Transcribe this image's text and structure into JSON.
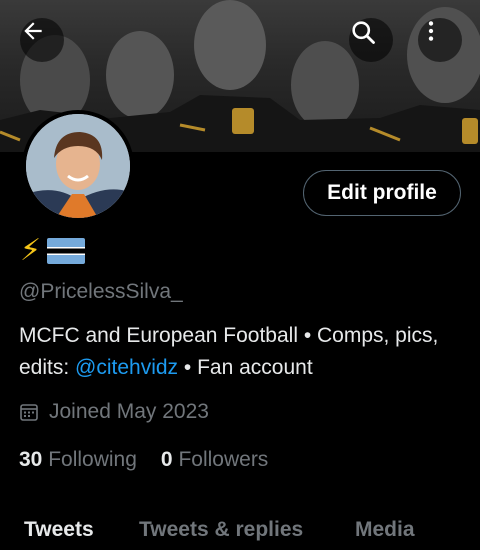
{
  "header": {
    "back_icon": "arrow-left-icon",
    "search_icon": "search-icon",
    "more_icon": "more-vertical-icon"
  },
  "profile": {
    "name_emoji": "⚡",
    "handle": "@PricelessSilva_",
    "edit_label": "Edit profile",
    "bio_part1": "MCFC and European Football • Comps, pics, edits: ",
    "bio_link": "@citehvidz",
    "bio_part2": " • Fan account",
    "joined": "Joined May 2023",
    "following_count": "30",
    "following_label": "Following",
    "followers_count": "0",
    "followers_label": "Followers"
  },
  "tabs": [
    {
      "label": "Tweets"
    },
    {
      "label": "Tweets & replies"
    },
    {
      "label": "Media"
    }
  ],
  "colors": {
    "background": "#000000",
    "accent_link": "#1d9bf0",
    "muted_text": "#71767b",
    "flag_blue": "#75aadb"
  }
}
